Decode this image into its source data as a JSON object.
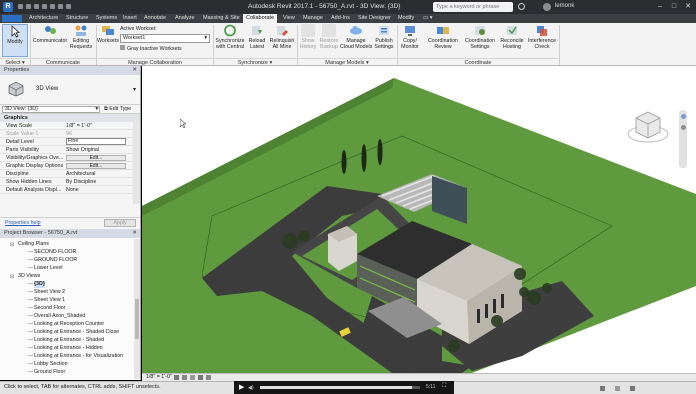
{
  "titlebar": {
    "logo": "R",
    "title": "Autodesk Revit 2017.1 -   56750_A.rvt - 3D View: {3D}",
    "search_placeholder": "Type a keyword or phrase",
    "user": "lemonk"
  },
  "tabs": [
    "Architecture",
    "Structure",
    "Systems",
    "Insert",
    "Annotate",
    "Analyze",
    "Massing & Site",
    "Collaborate",
    "View",
    "Manage",
    "Add-Ins",
    "Site Designer",
    "Modify"
  ],
  "active_tab": "Collaborate",
  "ribbon": {
    "modify": {
      "label": "Modify"
    },
    "select_label": "Select ▾",
    "communicate": {
      "communicator": "Communicator",
      "editing_requests_1": "Editing",
      "editing_requests_2": "Requests",
      "panel": "Communicate"
    },
    "manage_collab": {
      "worksets": "Worksets",
      "active_workset_label": "Active Workset:",
      "active_workset_value": "Workset1",
      "gray_inactive": "Gray Inactive Worksets",
      "panel": "Manage Collaboration"
    },
    "synchronize": {
      "sync_1": "Synchronize",
      "sync_2": "with Central",
      "reload_1": "Reload",
      "reload_2": "Latest",
      "relinquish_1": "Relinquish",
      "relinquish_2": "All Mine",
      "panel": "Synchronize ▾"
    },
    "manage_models": {
      "show_history_1": "Show",
      "show_history_2": "History",
      "restore_backup_1": "Restore",
      "restore_backup_2": "Backup",
      "manage_cloud_1": "Manage",
      "manage_cloud_2": "Cloud Models",
      "publish_1": "Publish",
      "publish_2": "Settings",
      "panel": "Manage Models ▾"
    },
    "coordinate": {
      "copy_monitor_1": "Copy/",
      "copy_monitor_2": "Monitor",
      "coord_review_1": "Coordination",
      "coord_review_2": "Review",
      "coord_settings_1": "Coordination",
      "coord_settings_2": "Settings",
      "reconcile_1": "Reconcile",
      "reconcile_2": "Hosting",
      "interference_1": "Interference",
      "interference_2": "Check",
      "panel": "Coordinate"
    }
  },
  "properties": {
    "header": "Properties",
    "type_name": "3D View",
    "instance_selector": "3D View: {3D}",
    "edit_type": "Edit Type",
    "section": "Graphics",
    "rows": [
      {
        "key": "View Scale",
        "value": "1/8\" = 1'-0\""
      },
      {
        "key": "Scale Value    1:",
        "value": "96"
      },
      {
        "key": "Detail Level",
        "value": "Fine"
      },
      {
        "key": "Parts Visibility",
        "value": "Show Original"
      },
      {
        "key": "Visibility/Graphics Ove...",
        "value": "Edit..."
      },
      {
        "key": "Graphic Display Options",
        "value": "Edit..."
      },
      {
        "key": "Discipline",
        "value": "Architectural"
      },
      {
        "key": "Show Hidden Lines",
        "value": "By Discipline"
      },
      {
        "key": "Default Analysis Displ...",
        "value": "None"
      }
    ],
    "help_link": "Properties help",
    "apply": "Apply"
  },
  "browser": {
    "header": "Project Browser - 56750_A.rvt",
    "items": [
      {
        "label": "Ceiling Plans",
        "level": 1,
        "expander": "⊟"
      },
      {
        "label": "SECOND FLOOR",
        "level": 2,
        "expander": ""
      },
      {
        "label": "GROUND FLOOR",
        "level": 2,
        "expander": ""
      },
      {
        "label": "Lower Level",
        "level": 2,
        "expander": ""
      },
      {
        "label": "3D Views",
        "level": 1,
        "expander": "⊟"
      },
      {
        "label": "{3D}",
        "level": 2,
        "expander": "",
        "selected": true
      },
      {
        "label": "Sheet View 2",
        "level": 2,
        "expander": ""
      },
      {
        "label": "Sheet View 1",
        "level": 2,
        "expander": ""
      },
      {
        "label": "Second Floor",
        "level": 2,
        "expander": ""
      },
      {
        "label": "Overall Axon_Shaded",
        "level": 2,
        "expander": ""
      },
      {
        "label": "Looking at Reception Counter",
        "level": 2,
        "expander": ""
      },
      {
        "label": "Looking at Entrance - Shaded Close",
        "level": 2,
        "expander": ""
      },
      {
        "label": "Looking at Entrance - Shaded",
        "level": 2,
        "expander": ""
      },
      {
        "label": "Looking at Entrance - Hidden",
        "level": 2,
        "expander": ""
      },
      {
        "label": "Looking at Entrance - for Visualization",
        "level": 2,
        "expander": ""
      },
      {
        "label": "Lobby Section",
        "level": 2,
        "expander": ""
      },
      {
        "label": "Ground Floor",
        "level": 2,
        "expander": ""
      }
    ]
  },
  "viewbar": {
    "scale": "1/8\" = 1'-0\""
  },
  "statusbar": {
    "text": "Click to select, TAB for alternates, CTRL adds, SHIFT unselects.",
    "video_time": "5:11"
  },
  "colors": {
    "accent": "#2a6fc4",
    "grass": "#5f9a3e",
    "road": "#3c3c3c"
  }
}
